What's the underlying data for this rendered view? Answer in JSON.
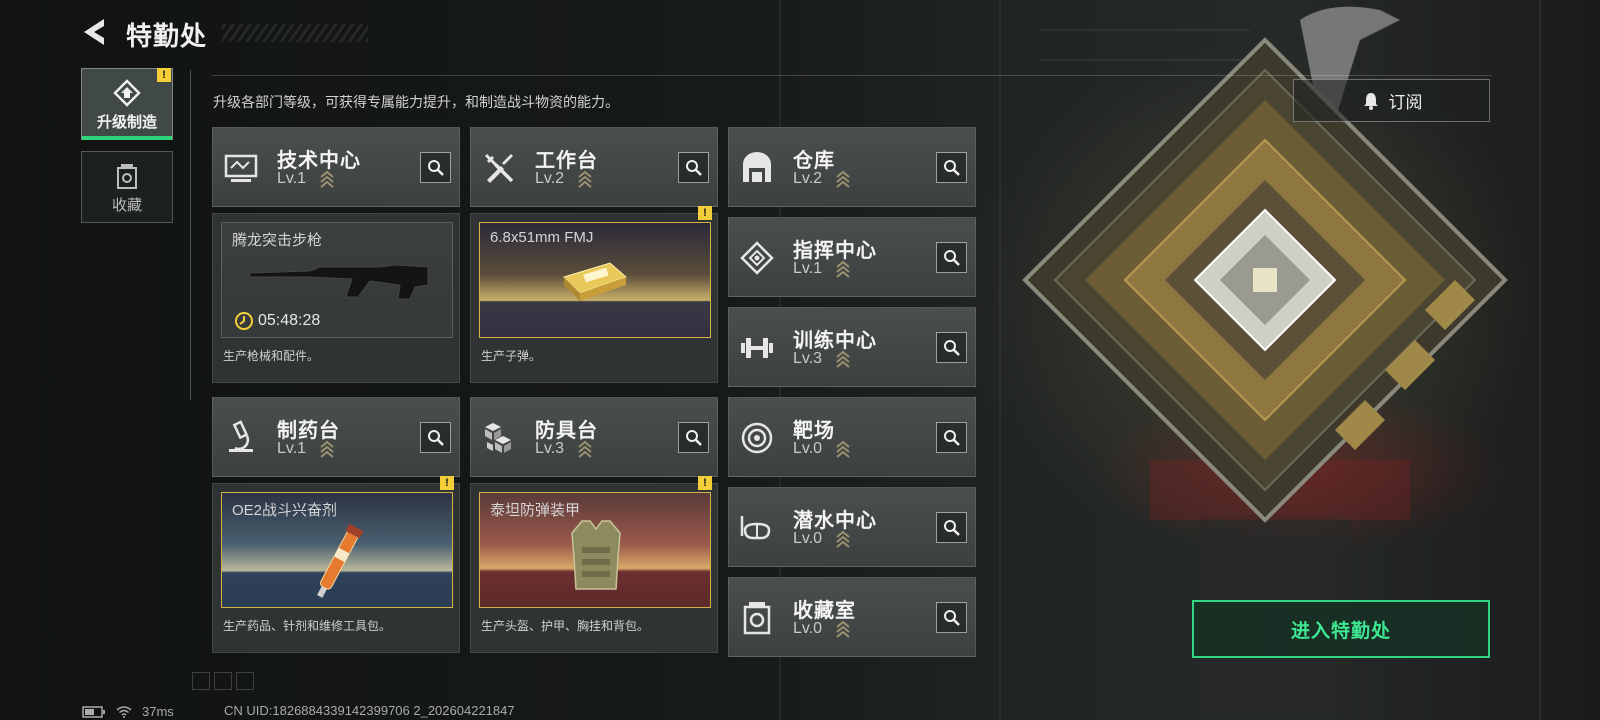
{
  "header": {
    "title": "特勤处"
  },
  "nav": {
    "tabs": [
      {
        "label": "升级制造",
        "active": true,
        "alert": "!"
      },
      {
        "label": "收藏",
        "active": false
      }
    ]
  },
  "description": "升级各部门等级，可获得专属能力提升，和制造战斗物资的能力。",
  "subscribe": {
    "label": "订阅"
  },
  "enter_button": {
    "label": "进入特勤处"
  },
  "facilities": [
    {
      "name": "技术中心",
      "level": "Lv.1",
      "icon": "monitor-icon"
    },
    {
      "name": "工作台",
      "level": "Lv.2",
      "icon": "tools-icon"
    },
    {
      "name": "仓库",
      "level": "Lv.2",
      "icon": "warehouse-icon"
    },
    {
      "name": "指挥中心",
      "level": "Lv.1",
      "icon": "command-icon"
    },
    {
      "name": "训练中心",
      "level": "Lv.3",
      "icon": "dumbbell-icon"
    },
    {
      "name": "制药台",
      "level": "Lv.1",
      "icon": "microscope-icon"
    },
    {
      "name": "防具台",
      "level": "Lv.3",
      "icon": "armor-blocks-icon"
    },
    {
      "name": "靶场",
      "level": "Lv.0",
      "icon": "target-icon"
    },
    {
      "name": "潜水中心",
      "level": "Lv.0",
      "icon": "diving-mask-icon"
    },
    {
      "name": "收藏室",
      "level": "Lv.0",
      "icon": "vault-icon"
    }
  ],
  "production": [
    {
      "item": "腾龙突击步枪",
      "timer": "05:48:28",
      "desc": "生产枪械和配件。"
    },
    {
      "item": "6.8x51mm FMJ",
      "desc": "生产子弹。",
      "alert": "!"
    },
    {
      "item": "OE2战斗兴奋剂",
      "desc": "生产药品、针剂和维修工具包。",
      "alert": "!"
    },
    {
      "item": "泰坦防弹装甲",
      "desc": "生产头盔、护甲、胸挂和背包。",
      "alert": "!"
    }
  ],
  "status": {
    "ping": "37ms",
    "uid": "CN UID:1826884339142399706 2_202604221847"
  },
  "colors": {
    "accent": "#2fd683",
    "alert": "#f4cf3a",
    "gold_frame": "#d6b24a"
  }
}
